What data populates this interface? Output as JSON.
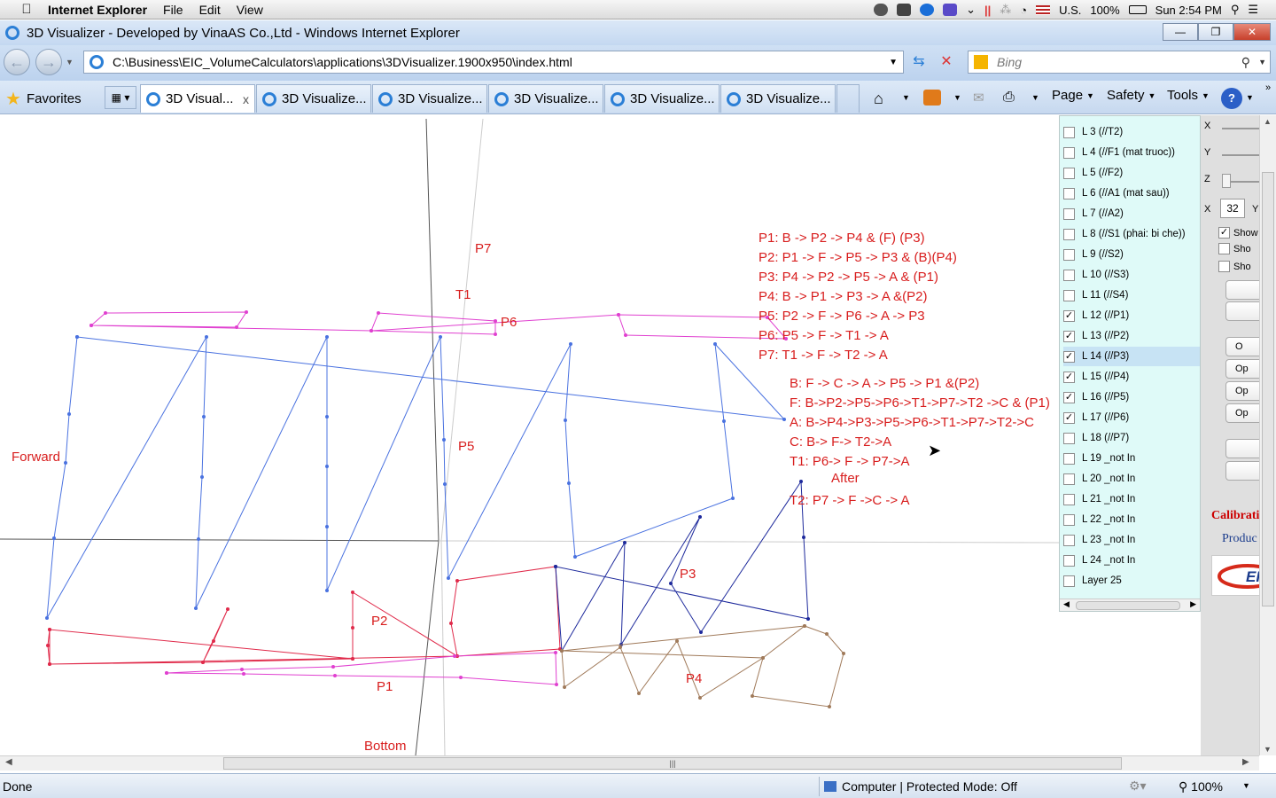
{
  "menubar": {
    "app": "Internet Explorer",
    "items": [
      "File",
      "Edit",
      "View"
    ],
    "input_source": "U.S.",
    "battery": "100%",
    "clock": "Sun 2:54 PM"
  },
  "window": {
    "title": "3D Visualizer - Developed by VinaAS Co.,Ltd - Windows Internet Explorer"
  },
  "address": {
    "url": "C:\\Business\\EIC_VolumeCalculators\\applications\\3DVisualizer.1900x950\\index.html",
    "search_placeholder": "Bing"
  },
  "toolbar": {
    "favorites": "Favorites",
    "tabs": [
      {
        "label": "3D Visual...",
        "active": true
      },
      {
        "label": "3D Visualize...",
        "active": false
      },
      {
        "label": "3D Visualize...",
        "active": false
      },
      {
        "label": "3D Visualize...",
        "active": false
      },
      {
        "label": "3D Visualize...",
        "active": false
      },
      {
        "label": "3D Visualize...",
        "active": false
      }
    ],
    "tab_close": "x",
    "page": "Page",
    "safety": "Safety",
    "tools": "Tools"
  },
  "canvas_labels": {
    "forward": "Forward",
    "bottom": "Bottom",
    "after": "After",
    "p1": "P1",
    "p2": "P2",
    "p3": "P3",
    "p4": "P4",
    "p5": "P5",
    "p6": "P6",
    "p7": "P7",
    "t1": "T1"
  },
  "legend": {
    "group1": [
      "P1: B -> P2 -> P4 & (F) (P3)",
      "P2: P1 -> F -> P5 -> P3 & (B)(P4)",
      "P3: P4 -> P2 -> P5 -> A & (P1)",
      "P4: B -> P1 -> P3 -> A &(P2)",
      "P5: P2 -> F -> P6 -> A -> P3",
      "P6: P5 -> F -> T1 -> A",
      "P7: T1 -> F -> T2 -> A"
    ],
    "group2": [
      "B: F -> C -> A -> P5 -> P1 &(P2)",
      "F: B->P2->P5->P6->T1->P7->T2 ->C & (P1)",
      "A: B->P4->P3->P5->P6->T1->P7->T2->C",
      "C: B-> F-> T2->A",
      "T1: P6-> F -> P7->A"
    ],
    "t2": "T2: P7 -> F ->C -> A"
  },
  "layers": [
    {
      "label": "L 3 (//T2)",
      "checked": false
    },
    {
      "label": "L 4 (//F1 (mat truoc))",
      "checked": false
    },
    {
      "label": "L 5 (//F2)",
      "checked": false
    },
    {
      "label": "L 6 (//A1 (mat sau))",
      "checked": false
    },
    {
      "label": "L 7 (//A2)",
      "checked": false
    },
    {
      "label": "L 8 (//S1 (phai: bi che))",
      "checked": false
    },
    {
      "label": "L 9 (//S2)",
      "checked": false
    },
    {
      "label": "L 10 (//S3)",
      "checked": false
    },
    {
      "label": "L 11 (//S4)",
      "checked": false
    },
    {
      "label": "L 12 (//P1)",
      "checked": true
    },
    {
      "label": "L 13 (//P2)",
      "checked": true
    },
    {
      "label": "L 14 (//P3)",
      "checked": true,
      "selected": true
    },
    {
      "label": "L 15 (//P4)",
      "checked": true
    },
    {
      "label": "L 16 (//P5)",
      "checked": true
    },
    {
      "label": "L 17 (//P6)",
      "checked": true
    },
    {
      "label": "L 18 (//P7)",
      "checked": false
    },
    {
      "label": "L 19 _not In",
      "checked": false
    },
    {
      "label": "L 20 _not In",
      "checked": false
    },
    {
      "label": "L 21 _not In",
      "checked": false
    },
    {
      "label": "L 22 _not In",
      "checked": false
    },
    {
      "label": "L 23 _not In",
      "checked": false
    },
    {
      "label": "L 24 _not In",
      "checked": false
    },
    {
      "label": "Layer 25",
      "checked": false
    }
  ],
  "controls": {
    "axis_x": "X",
    "axis_y": "Y",
    "axis_z": "Z",
    "x_label": "X",
    "x_value": "32",
    "y_label_partial": "Y",
    "show1": "Show",
    "show2": "Sho",
    "show3": "Sho",
    "op_buttons": [
      "O",
      "Op",
      "Op",
      "Op"
    ],
    "calibration": "Calibrati",
    "product": "Produc"
  },
  "status": {
    "left": "Done",
    "zone": "Computer | Protected Mode: Off",
    "zoom": "100%"
  },
  "colors": {
    "label_red": "#d81e1e",
    "blue": "#4a72e0",
    "magenta": "#e040d0",
    "red": "#e02a4a",
    "navy": "#1e2a9c",
    "brown": "#a07a5a"
  }
}
